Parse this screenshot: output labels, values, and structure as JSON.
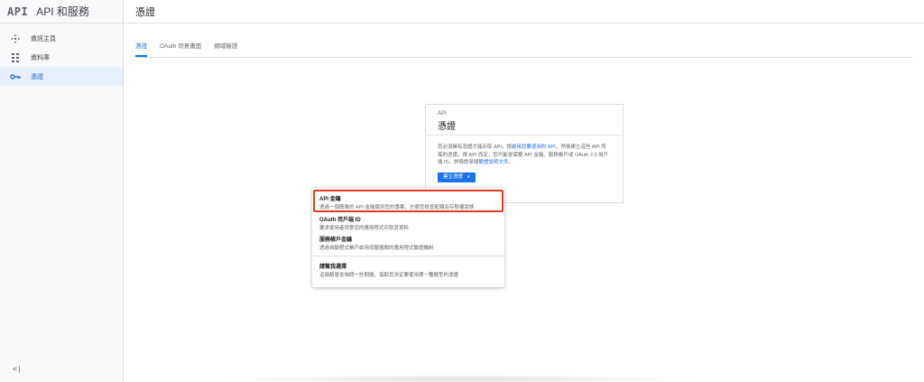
{
  "app": {
    "logo": "API",
    "title": "API 和服務"
  },
  "sidebar": {
    "items": [
      {
        "label": "資訊主頁",
        "icon": "dashboard-icon"
      },
      {
        "label": "資料庫",
        "icon": "library-icon"
      },
      {
        "label": "憑證",
        "icon": "key-icon"
      }
    ],
    "collapse_label": "<|"
  },
  "header": {
    "page_title": "憑證"
  },
  "tabs": [
    {
      "label": "憑證"
    },
    {
      "label": "OAuth 同意畫面"
    },
    {
      "label": "網域驗證"
    }
  ],
  "card": {
    "overline": "API",
    "title": "憑證",
    "body_part1": "您必須擁有憑證才能存取 API。請",
    "body_link1": "啟用您要使用的 API",
    "body_part2": "，然後建立這些 API 所需的憑證。視 API 而定，您可能會需要 API 金鑰、服務帳戶或 OAuth 2.0 用戶端 ID。詳情請參閱",
    "body_link2": "驗證說明文件",
    "body_part3": "。",
    "create_button": "建立憑證",
    "create_caret": "▾"
  },
  "dropdown": {
    "items": [
      {
        "title": "API 金鑰",
        "desc": "透過一個簡單的 API 金鑰識別您的專案，方便您檢查配額及存取權狀態"
      },
      {
        "title": "OAuth 用戶端 ID",
        "desc": "要求使用者同意您的應用程式存取其資料"
      },
      {
        "title": "服務帳戶金鑰",
        "desc": "透過自動程式帳戶啟用伺服器間的應用程式驗證機制"
      },
      {
        "title": "請幫我選擇",
        "desc": "這個精靈會詢問一些問題，協助您決定要使用哪一種類型的憑證"
      }
    ]
  },
  "colors": {
    "accent": "#1a73e8",
    "highlight_box": "#e23c20",
    "active_nav_bg": "#e8f0fe"
  }
}
